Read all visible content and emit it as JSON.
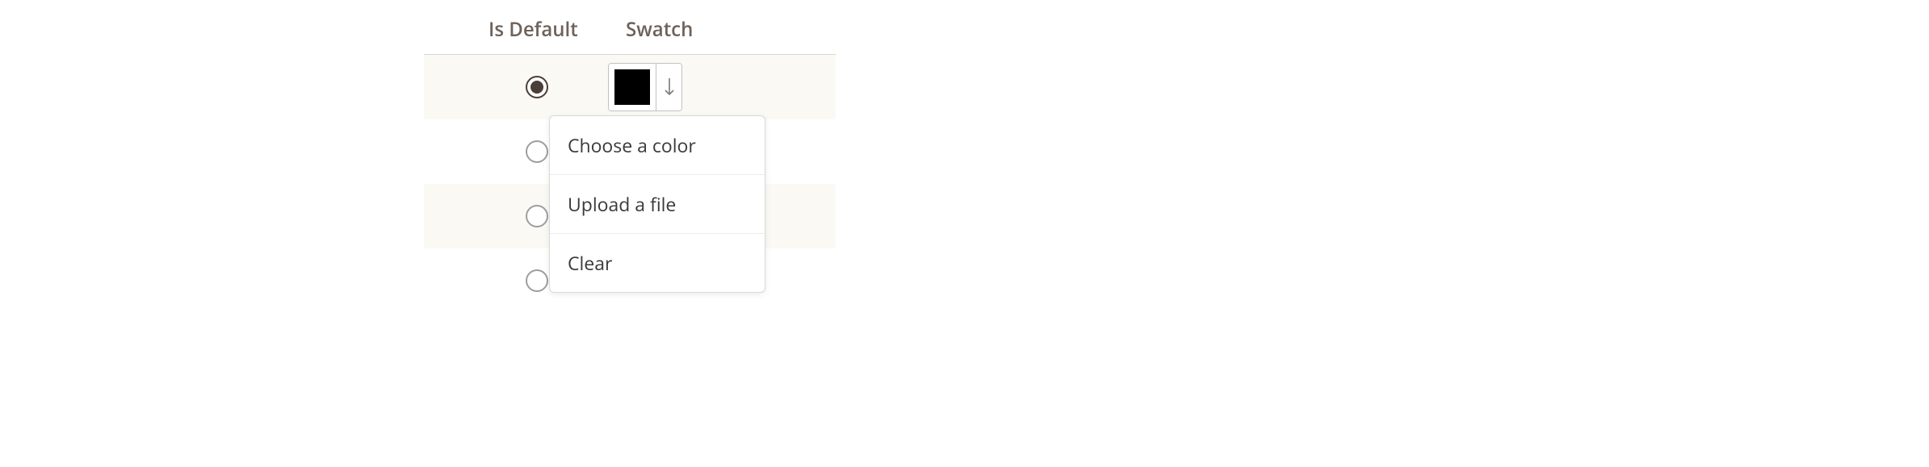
{
  "headers": {
    "is_default": "Is Default",
    "swatch": "Swatch"
  },
  "rows": [
    {
      "selected": true,
      "swatch_color": "#000000"
    },
    {
      "selected": false
    },
    {
      "selected": false
    },
    {
      "selected": false
    }
  ],
  "dropdown": {
    "choose_color": "Choose a color",
    "upload_file": "Upload a file",
    "clear": "Clear"
  }
}
